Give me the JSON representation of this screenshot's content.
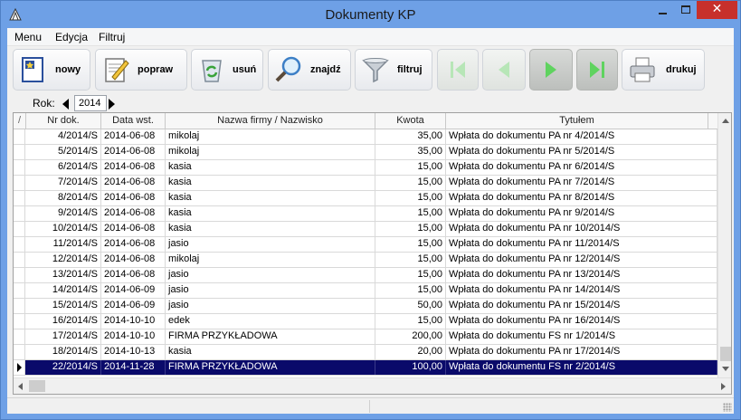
{
  "window": {
    "title": "Dokumenty KP"
  },
  "menu": [
    "Menu",
    "Edycja",
    "Filtruj"
  ],
  "toolbar": {
    "nowy": "nowy",
    "popraw": "popraw",
    "usun": "usuń",
    "znajdz": "znajdź",
    "filtruj": "filtruj",
    "drukuj": "drukuj"
  },
  "year": {
    "label": "Rok:",
    "value": "2014"
  },
  "grid": {
    "columns": [
      "Nr dok.",
      "Data wst.",
      "Nazwa firmy / Nazwisko",
      "Kwota",
      "Tytułem"
    ],
    "sort_marker": "/",
    "rows": [
      [
        "4/2014/S",
        "2014-06-08",
        "mikolaj",
        "35,00",
        "Wpłata do dokumentu PA nr 4/2014/S"
      ],
      [
        "5/2014/S",
        "2014-06-08",
        "mikolaj",
        "35,00",
        "Wpłata do dokumentu PA nr 5/2014/S"
      ],
      [
        "6/2014/S",
        "2014-06-08",
        "kasia",
        "15,00",
        "Wpłata do dokumentu PA nr 6/2014/S"
      ],
      [
        "7/2014/S",
        "2014-06-08",
        "kasia",
        "15,00",
        "Wpłata do dokumentu PA nr 7/2014/S"
      ],
      [
        "8/2014/S",
        "2014-06-08",
        "kasia",
        "15,00",
        "Wpłata do dokumentu PA nr 8/2014/S"
      ],
      [
        "9/2014/S",
        "2014-06-08",
        "kasia",
        "15,00",
        "Wpłata do dokumentu PA nr 9/2014/S"
      ],
      [
        "10/2014/S",
        "2014-06-08",
        "kasia",
        "15,00",
        "Wpłata do dokumentu PA nr 10/2014/S"
      ],
      [
        "11/2014/S",
        "2014-06-08",
        "jasio",
        "15,00",
        "Wpłata do dokumentu PA nr 11/2014/S"
      ],
      [
        "12/2014/S",
        "2014-06-08",
        "mikolaj",
        "15,00",
        "Wpłata do dokumentu PA nr 12/2014/S"
      ],
      [
        "13/2014/S",
        "2014-06-08",
        "jasio",
        "15,00",
        "Wpłata do dokumentu PA nr 13/2014/S"
      ],
      [
        "14/2014/S",
        "2014-06-09",
        "jasio",
        "15,00",
        "Wpłata do dokumentu PA nr 14/2014/S"
      ],
      [
        "15/2014/S",
        "2014-06-09",
        "jasio",
        "50,00",
        "Wpłata do dokumentu PA nr 15/2014/S"
      ],
      [
        "16/2014/S",
        "2014-10-10",
        "edek",
        "15,00",
        "Wpłata do dokumentu PA nr 16/2014/S"
      ],
      [
        "17/2014/S",
        "2014-10-10",
        "FIRMA PRZYKŁADOWA",
        "200,00",
        "Wpłata do dokumentu FS nr 1/2014/S"
      ],
      [
        "18/2014/S",
        "2014-10-13",
        "kasia",
        "20,00",
        "Wpłata do dokumentu PA nr 17/2014/S"
      ],
      [
        "22/2014/S",
        "2014-11-28",
        "FIRMA PRZYKŁADOWA",
        "100,00",
        "Wpłata do dokumentu FS nr 2/2014/S"
      ]
    ],
    "selected_index": 15
  },
  "colors": {
    "title_bar": "#6ea0e6",
    "close": "#c7302b",
    "selected_row": "#0a0a6a",
    "nav_green": "#5fd35f"
  },
  "icons": [
    "app-icon",
    "new-document-icon",
    "edit-document-icon",
    "recycle-bin-icon",
    "magnifier-icon",
    "funnel-filter-icon",
    "first-record-icon",
    "previous-record-icon",
    "next-record-icon",
    "last-record-icon",
    "printer-icon"
  ]
}
